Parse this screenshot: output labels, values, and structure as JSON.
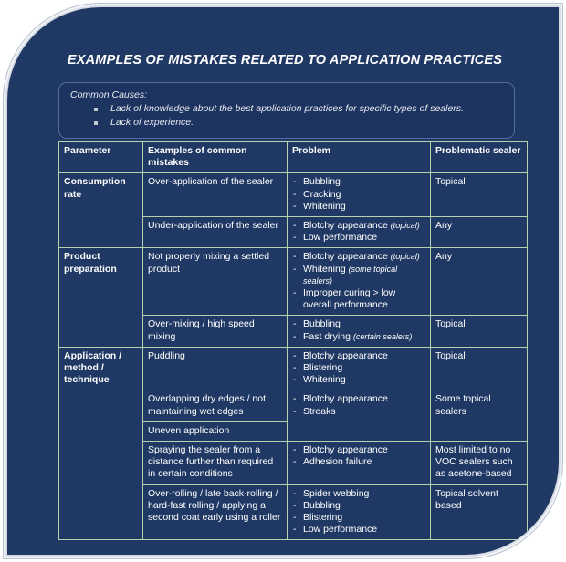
{
  "slide": {
    "title": "EXAMPLES OF MISTAKES RELATED TO APPLICATION PRACTICES",
    "accent_border_color": "#b9d0ad",
    "background_color": "#203864",
    "callout_background_color": "#1d3360",
    "callout_border_color": "#4f6d9e",
    "text_color": "#ffffff"
  },
  "common_causes": {
    "heading": "Common Causes:",
    "items": [
      "Lack of knowledge about the best application practices for specific types of sealers.",
      "Lack of experience."
    ]
  },
  "table": {
    "headers": {
      "parameter": "Parameter",
      "mistakes": "Examples of common mistakes",
      "problem": "Problem",
      "sealer": "Problematic sealer"
    },
    "groups": [
      {
        "parameter": "Consumption rate",
        "rows": [
          {
            "mistake": "Over-application of the sealer",
            "problems": [
              {
                "text": "Bubbling",
                "note": ""
              },
              {
                "text": "Cracking",
                "note": ""
              },
              {
                "text": "Whitening",
                "note": ""
              }
            ],
            "sealer": "Topical"
          },
          {
            "mistake": "Under-application of the sealer",
            "problems": [
              {
                "text": "Blotchy appearance",
                "note": "(topical)"
              },
              {
                "text": "Low performance",
                "note": ""
              }
            ],
            "sealer": "Any"
          }
        ]
      },
      {
        "parameter": "Product preparation",
        "rows": [
          {
            "mistake": "Not properly mixing a settled product",
            "problems": [
              {
                "text": "Blotchy appearance",
                "note": "(topical)"
              },
              {
                "text": "Whitening",
                "note": "(some topical sealers)"
              },
              {
                "text": "Improper curing > low overall performance",
                "note": ""
              }
            ],
            "sealer": "Any"
          },
          {
            "mistake": "Over-mixing / high speed mixing",
            "problems": [
              {
                "text": "Bubbling",
                "note": ""
              },
              {
                "text": "Fast drying",
                "note": "(certain sealers)"
              }
            ],
            "sealer": "Topical"
          }
        ]
      },
      {
        "parameter": "Application / method / technique",
        "rows": [
          {
            "mistake": "Puddling",
            "problems": [
              {
                "text": "Blotchy appearance",
                "note": ""
              },
              {
                "text": "Blistering",
                "note": ""
              },
              {
                "text": "Whitening",
                "note": ""
              }
            ],
            "sealer": "Topical"
          },
          {
            "mistake": "Overlapping dry edges / not maintaining wet edges",
            "mistake_extra": "Uneven application",
            "problems": [
              {
                "text": "Blotchy appearance",
                "note": ""
              },
              {
                "text": "Streaks",
                "note": ""
              }
            ],
            "sealer": "Some topical sealers"
          },
          {
            "mistake": "Spraying the sealer from a distance further than required in certain conditions",
            "problems": [
              {
                "text": "Blotchy appearance",
                "note": ""
              },
              {
                "text": "Adhesion failure",
                "note": ""
              }
            ],
            "sealer": "Most limited to no VOC sealers such as acetone-based"
          },
          {
            "mistake": "Over-rolling / late back-rolling / hard-fast rolling / applying a second coat early using a roller",
            "problems": [
              {
                "text": "Spider webbing",
                "note": ""
              },
              {
                "text": "Bubbling",
                "note": ""
              },
              {
                "text": "Blistering",
                "note": ""
              },
              {
                "text": "Low performance",
                "note": ""
              }
            ],
            "sealer": "Topical solvent based"
          }
        ]
      }
    ]
  }
}
